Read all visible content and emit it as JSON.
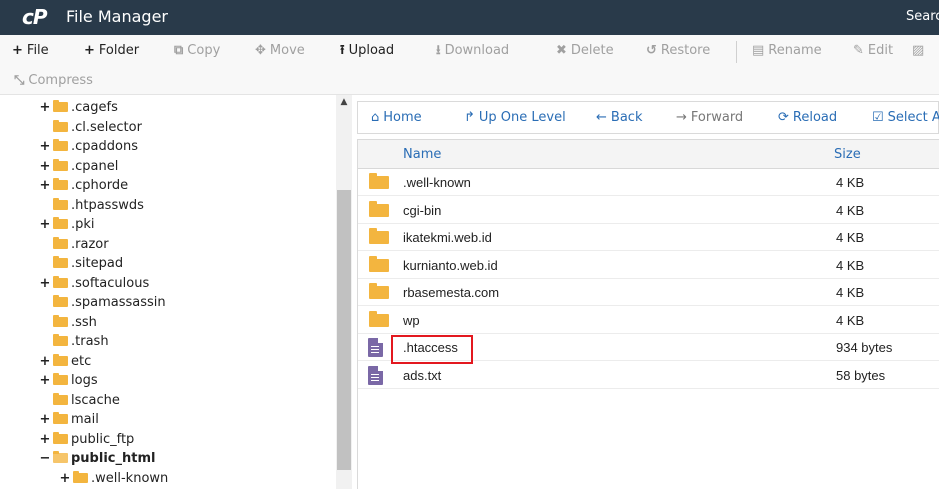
{
  "header": {
    "logo": "cP",
    "title": "File Manager",
    "search_label": "Search"
  },
  "toolbar": {
    "file": "File",
    "folder": "Folder",
    "copy": "Copy",
    "move": "Move",
    "upload": "Upload",
    "download": "Download",
    "delete": "Delete",
    "restore": "Restore",
    "rename": "Rename",
    "edit": "Edit",
    "compress": "Compress"
  },
  "tree": [
    {
      "label": ".cagefs",
      "toggle": "+"
    },
    {
      "label": ".cl.selector",
      "toggle": ""
    },
    {
      "label": ".cpaddons",
      "toggle": "+"
    },
    {
      "label": ".cpanel",
      "toggle": "+"
    },
    {
      "label": ".cphorde",
      "toggle": "+"
    },
    {
      "label": ".htpasswds",
      "toggle": ""
    },
    {
      "label": ".pki",
      "toggle": "+"
    },
    {
      "label": ".razor",
      "toggle": ""
    },
    {
      "label": ".sitepad",
      "toggle": ""
    },
    {
      "label": ".softaculous",
      "toggle": "+"
    },
    {
      "label": ".spamassassin",
      "toggle": ""
    },
    {
      "label": ".ssh",
      "toggle": ""
    },
    {
      "label": ".trash",
      "toggle": ""
    },
    {
      "label": "etc",
      "toggle": "+"
    },
    {
      "label": "logs",
      "toggle": "+"
    },
    {
      "label": "lscache",
      "toggle": ""
    },
    {
      "label": "mail",
      "toggle": "+"
    },
    {
      "label": "public_ftp",
      "toggle": "+"
    },
    {
      "label": "public_html",
      "toggle": "−"
    },
    {
      "label": ".well-known",
      "toggle": "+"
    }
  ],
  "nav": {
    "home": "Home",
    "up": "Up One Level",
    "back": "Back",
    "forward": "Forward",
    "reload": "Reload",
    "select_all": "Select All"
  },
  "table": {
    "col_name": "Name",
    "col_size": "Size",
    "rows": [
      {
        "name": ".well-known",
        "size": "4 KB",
        "type": "folder"
      },
      {
        "name": "cgi-bin",
        "size": "4 KB",
        "type": "folder"
      },
      {
        "name": "ikatekmi.web.id",
        "size": "4 KB",
        "type": "folder"
      },
      {
        "name": "kurnianto.web.id",
        "size": "4 KB",
        "type": "folder"
      },
      {
        "name": "rbasemesta.com",
        "size": "4 KB",
        "type": "folder"
      },
      {
        "name": "wp",
        "size": "4 KB",
        "type": "folder"
      },
      {
        "name": ".htaccess",
        "size": "934 bytes",
        "type": "file"
      },
      {
        "name": "ads.txt",
        "size": "58 bytes",
        "type": "file"
      }
    ]
  },
  "colors": {
    "header_bg": "#293a4a",
    "link": "#2a6db5",
    "folder": "#f3b53f",
    "file": "#7a68a6",
    "highlight": "#e3181f"
  }
}
